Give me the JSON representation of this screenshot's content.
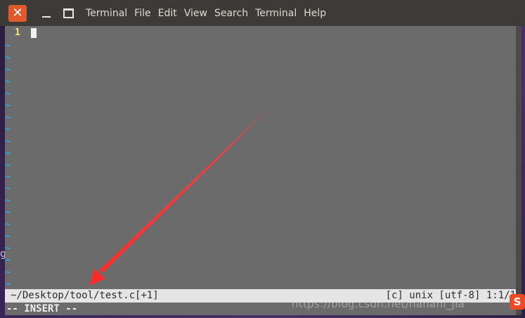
{
  "menubar": {
    "close_glyph": "✕",
    "items": [
      "Terminal",
      "File",
      "Edit",
      "View",
      "Search",
      "Terminal",
      "Help"
    ]
  },
  "editor": {
    "line_number": "1",
    "tilde": "~",
    "tilde_count": 22
  },
  "statusline": {
    "path": "~/Desktop/tool/test.c",
    "modified_open": "[",
    "modified": "+1]",
    "right": "[c] unix [utf-8] 1:1/1"
  },
  "modeline": {
    "mode": "-- INSERT --"
  },
  "watermark": {
    "text": "https://blog.csdn.net/hanani_jia"
  },
  "desktop": {
    "edge_char": "g"
  },
  "sogou": {
    "letter": "S"
  },
  "colors": {
    "menubar_bg": "#3c3b37",
    "terminal_bg": "#6b6b6b",
    "tilde": "#2ea6d6",
    "line_number": "#f0e86a",
    "close_button": "#e0582b",
    "annotation_arrow": "#ff3b3b"
  }
}
